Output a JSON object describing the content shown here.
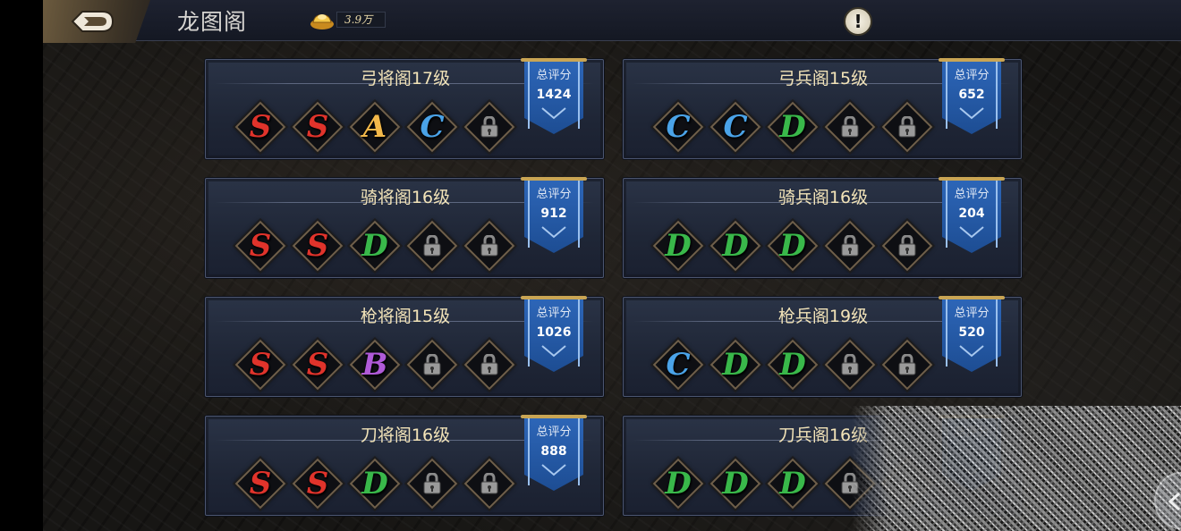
{
  "header": {
    "title": "龙图阁",
    "gold": "3.9万",
    "info_glyph": "!"
  },
  "score_label": "总评分",
  "cards": [
    {
      "name": "弓将阁17级",
      "score": "1424",
      "slots": [
        "S",
        "S",
        "A",
        "C",
        "lock"
      ]
    },
    {
      "name": "弓兵阁15级",
      "score": "652",
      "slots": [
        "C",
        "C",
        "D",
        "lock",
        "lock"
      ]
    },
    {
      "name": "骑将阁16级",
      "score": "912",
      "slots": [
        "S",
        "S",
        "D",
        "lock",
        "lock"
      ]
    },
    {
      "name": "骑兵阁16级",
      "score": "204",
      "slots": [
        "D",
        "D",
        "D",
        "lock",
        "lock"
      ]
    },
    {
      "name": "枪将阁15级",
      "score": "1026",
      "slots": [
        "S",
        "S",
        "B",
        "lock",
        "lock"
      ]
    },
    {
      "name": "枪兵阁19级",
      "score": "520",
      "slots": [
        "C",
        "D",
        "D",
        "lock",
        "lock"
      ]
    },
    {
      "name": "刀将阁16级",
      "score": "888",
      "slots": [
        "S",
        "S",
        "D",
        "lock",
        "lock"
      ]
    },
    {
      "name": "刀兵阁16级",
      "score": "",
      "slots": [
        "D",
        "D",
        "D",
        "lock",
        "lock"
      ]
    }
  ],
  "grade_colors": {
    "S": "#e0332b",
    "A": "#f2b84a",
    "B": "#b05ad8",
    "C": "#4aa3e8",
    "D": "#39b84a"
  }
}
